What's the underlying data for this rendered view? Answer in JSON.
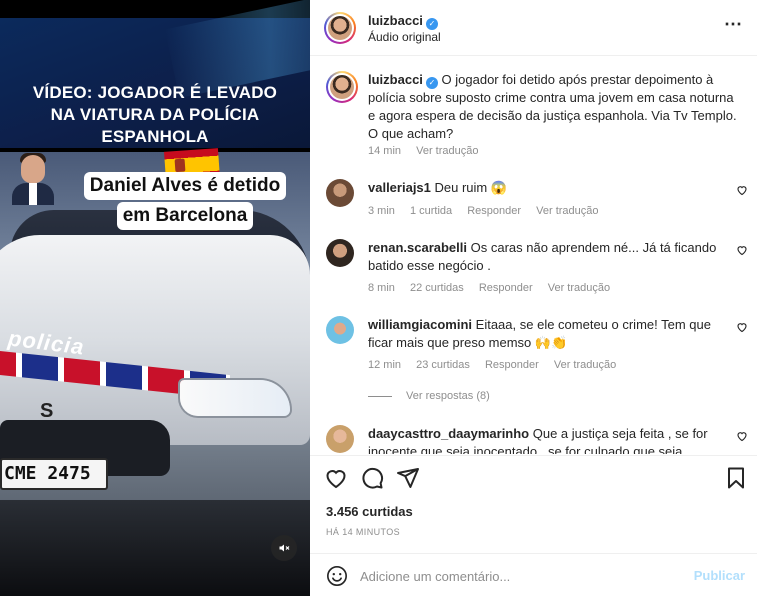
{
  "video": {
    "headline": [
      "VÍDEO: JOGADOR É LEVADO",
      "NA VIATURA DA POLÍCIA",
      "ESPANHOLA"
    ],
    "overlay_title": [
      "Daniel Alves é detido",
      "em Barcelona"
    ],
    "car_text": "policia",
    "car_brand": "S",
    "plate": "CME 2475",
    "mute_icon": "muted-speaker-icon"
  },
  "header": {
    "username": "luizbacci",
    "subtitle": "Áudio original",
    "more_icon": "more-horizontal-icon"
  },
  "caption": {
    "username": "luizbacci",
    "text": "O jogador foi detido após prestar depoimento à polícia sobre suposto crime contra uma jovem em casa noturna e agora espera de decisão da justiça espanhola. Via Tv Templo. O que acham?",
    "time": "14 min",
    "translate": "Ver tradução"
  },
  "comments": [
    {
      "username": "valleriajs1",
      "text": "Deu ruim 😱",
      "time": "3 min",
      "likes": "1 curtida",
      "reply": "Responder",
      "translate": "Ver tradução"
    },
    {
      "username": "renan.scarabelli",
      "text": "Os caras não aprendem né... Já tá ficando batido esse negócio .",
      "time": "8 min",
      "likes": "22 curtidas",
      "reply": "Responder",
      "translate": "Ver tradução"
    },
    {
      "username": "williamgiacomini",
      "text": "Eitaaa, se ele cometeu o crime! Tem que ficar mais que preso memso 🙌👏",
      "time": "12 min",
      "likes": "23 curtidas",
      "reply": "Responder",
      "translate": "Ver tradução",
      "view_replies": "Ver respostas (8)"
    },
    {
      "username": "daaycasttro_daaymarinho",
      "text": "Que a justiça seja feita , se for inocente que seja inocentado , se for culpado que seja",
      "time": "",
      "likes": "",
      "reply": "",
      "translate": ""
    }
  ],
  "actions": {
    "likes": "3.456 curtidas",
    "time_ago": "HÁ 14 MINUTOS"
  },
  "composer": {
    "placeholder": "Adicione um comentário...",
    "publish": "Publicar"
  },
  "colors": {
    "accent": "#0095f6",
    "muted": "#8e8e8e",
    "publish_disabled": "#b2dffc",
    "verified": "#3897f0"
  }
}
